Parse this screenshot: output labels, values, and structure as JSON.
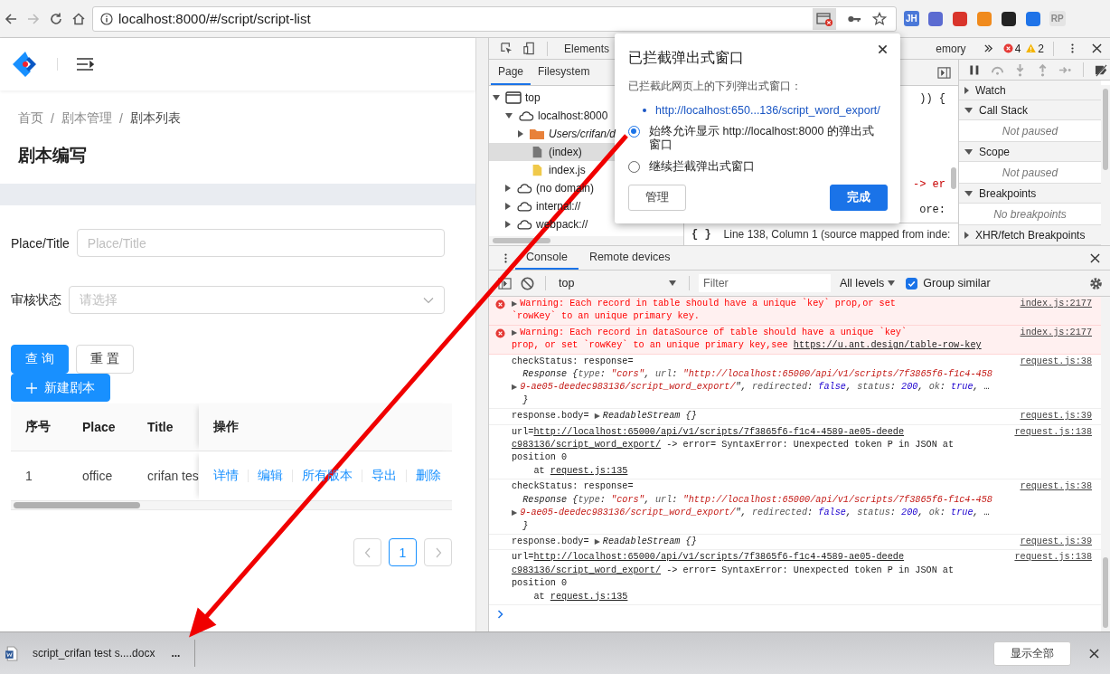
{
  "browser": {
    "url": "localhost:8000/#/script/script-list",
    "extensions": [
      {
        "kind": "badge",
        "label": "JH"
      },
      {
        "kind": "icon",
        "color": "#5b6bd1"
      },
      {
        "kind": "icon",
        "color": "#d9342b"
      },
      {
        "kind": "icon",
        "color": "#f08a1c"
      },
      {
        "kind": "icon",
        "color": "#222222"
      },
      {
        "kind": "icon",
        "color": "#1e73e8"
      },
      {
        "kind": "faded-badge",
        "label": "RP"
      }
    ]
  },
  "app": {
    "breadcrumb": [
      "首页",
      "剧本管理",
      "剧本列表"
    ],
    "breadcrumb_separator": "/",
    "page_title": "剧本编写",
    "form": [
      {
        "kind": "input",
        "label": "Place/Title",
        "placeholder": "Place/Title"
      },
      {
        "kind": "select",
        "label": "审核状态",
        "placeholder": "请选择"
      }
    ],
    "buttons": [
      {
        "kind": "primary",
        "label": "查 询"
      },
      {
        "kind": "default",
        "label": "重 置"
      }
    ],
    "new_button": "新建剧本",
    "table": {
      "columns": [
        "序号",
        "Place",
        "Title",
        "操作"
      ],
      "rows": [
        {
          "cells": [
            "1",
            "office",
            "crifan tes"
          ],
          "actions": [
            "详情",
            "编辑",
            "所有版本",
            "导出",
            "删除"
          ]
        }
      ]
    },
    "pagination": [
      {
        "kind": "prev"
      },
      {
        "kind": "page",
        "label": "1",
        "selected": true
      },
      {
        "kind": "next"
      }
    ]
  },
  "devtools": {
    "tabs": [
      {
        "label": "Elements",
        "selected": false
      },
      {
        "label": "emory",
        "selected": false
      }
    ],
    "errors": "4",
    "warnings": "2",
    "navigator": {
      "tabs": [
        {
          "label": "Page",
          "selected": true
        },
        {
          "label": "Filesystem",
          "selected": false
        }
      ],
      "tree": [
        {
          "kind": "frame",
          "label": "top",
          "expanded": true,
          "children": [
            {
              "kind": "cloud",
              "label": "localhost:8000",
              "expanded": true,
              "children": [
                {
                  "kind": "folder",
                  "label": "Users/crifan/d",
                  "expanded": false
                },
                {
                  "kind": "file",
                  "label": "(index)",
                  "selected": true
                },
                {
                  "kind": "script",
                  "label": "index.js",
                  "selected": false
                }
              ]
            },
            {
              "kind": "cloud",
              "label": "(no domain)",
              "expanded": false
            },
            {
              "kind": "cloud",
              "label": "internal://",
              "expanded": false
            },
            {
              "kind": "cloud",
              "label": "webpack://",
              "expanded": false
            }
          ]
        }
      ]
    },
    "code_fragments": [
      {
        "kind": "plain",
        "text": ")) {"
      },
      {
        "kind": "error",
        "text": "-> er"
      },
      {
        "kind": "plain",
        "text": "ore:"
      }
    ],
    "pretty_print": "{ }",
    "status": "Line 138, Column 1   (source mapped from inde:",
    "debugger": [
      {
        "title": "Watch",
        "expanded": false
      },
      {
        "title": "Call Stack",
        "expanded": true,
        "content": "Not paused"
      },
      {
        "title": "Scope",
        "expanded": true,
        "content": "Not paused"
      },
      {
        "title": "Breakpoints",
        "expanded": true,
        "content": "No breakpoints"
      },
      {
        "title": "XHR/fetch Breakpoints",
        "expanded": false
      }
    ],
    "console": {
      "tabs": [
        {
          "label": "Console",
          "selected": true
        },
        {
          "label": "Remote devices",
          "selected": false
        }
      ],
      "context": "top",
      "filter_placeholder": "Filter",
      "levels": "All levels",
      "group_similar": {
        "label": "Group similar",
        "checked": true
      },
      "messages": [
        {
          "kind": "error",
          "source": "index.js:2177",
          "lines": [
            [
              {
                "kind": "toggle",
                "t": "▶"
              },
              {
                "kind": "plain",
                "t": "Warning: Each record in table should have a unique `key` prop,or set"
              }
            ],
            [
              {
                "kind": "plain",
                "t": "`rowKey` to an unique primary key."
              }
            ]
          ]
        },
        {
          "kind": "error",
          "source": "index.js:2177",
          "lines": [
            [
              {
                "kind": "toggle",
                "t": "▶"
              },
              {
                "kind": "plain",
                "t": "Warning: Each record in dataSource of table should have a unique `key`"
              }
            ],
            [
              {
                "kind": "plain",
                "t": "prop, or set `rowKey` to an unique primary key,see "
              },
              {
                "kind": "link",
                "t": "https://u.ant.design/table-row-key"
              }
            ]
          ]
        },
        {
          "kind": "log",
          "source": "request.js:38",
          "lines": [
            [
              {
                "kind": "plain",
                "t": "checkStatus: response="
              }
            ],
            [
              {
                "kind": "italic",
                "t": "  Response {"
              },
              {
                "kind": "key",
                "t": "type"
              },
              {
                "kind": "italic",
                "t": ": "
              },
              {
                "kind": "string",
                "t": "\"cors\""
              },
              {
                "kind": "italic",
                "t": ", "
              },
              {
                "kind": "key",
                "t": "url"
              },
              {
                "kind": "italic",
                "t": ": "
              },
              {
                "kind": "string",
                "t": "\"http://localhost:65000/api/v1/scripts/7f3865f6-f1c4-458"
              }
            ],
            [
              {
                "kind": "toggle",
                "t": "▶"
              },
              {
                "kind": "string",
                "t": "9-ae05-deedec983136/script_word_export/"
              },
              {
                "kind": "italic",
                "t": "\", "
              },
              {
                "kind": "key",
                "t": "redirected"
              },
              {
                "kind": "italic",
                "t": ": "
              },
              {
                "kind": "value",
                "t": "false"
              },
              {
                "kind": "italic",
                "t": ", "
              },
              {
                "kind": "key",
                "t": "status"
              },
              {
                "kind": "italic",
                "t": ": "
              },
              {
                "kind": "value",
                "t": "200"
              },
              {
                "kind": "italic",
                "t": ", "
              },
              {
                "kind": "key",
                "t": "ok"
              },
              {
                "kind": "italic",
                "t": ": "
              },
              {
                "kind": "value",
                "t": "true"
              },
              {
                "kind": "italic",
                "t": ", …"
              }
            ],
            [
              {
                "kind": "italic",
                "t": "  }"
              }
            ]
          ]
        },
        {
          "kind": "log",
          "source": "request.js:39",
          "lines": [
            [
              {
                "kind": "plain",
                "t": "response.body= "
              },
              {
                "kind": "toggle",
                "t": "▶"
              },
              {
                "kind": "italic",
                "t": "ReadableStream {}"
              }
            ]
          ]
        },
        {
          "kind": "log",
          "source": "request.js:138",
          "lines": [
            [
              {
                "kind": "plain",
                "t": "url="
              },
              {
                "kind": "link",
                "t": "http://localhost:65000/api/v1/scripts/7f3865f6-f1c4-4589-ae05-deede"
              }
            ],
            [
              {
                "kind": "link",
                "t": "c983136/script_word_export/"
              },
              {
                "kind": "plain",
                "t": " -> error= SyntaxError: Unexpected token P in JSON at"
              }
            ],
            [
              {
                "kind": "plain",
                "t": "position 0"
              }
            ],
            [
              {
                "kind": "plain",
                "t": "    at "
              },
              {
                "kind": "link",
                "t": "request.js:135"
              }
            ]
          ]
        },
        {
          "kind": "log",
          "source": "request.js:38",
          "lines": [
            [
              {
                "kind": "plain",
                "t": "checkStatus: response="
              }
            ],
            [
              {
                "kind": "italic",
                "t": "  Response {"
              },
              {
                "kind": "key",
                "t": "type"
              },
              {
                "kind": "italic",
                "t": ": "
              },
              {
                "kind": "string",
                "t": "\"cors\""
              },
              {
                "kind": "italic",
                "t": ", "
              },
              {
                "kind": "key",
                "t": "url"
              },
              {
                "kind": "italic",
                "t": ": "
              },
              {
                "kind": "string",
                "t": "\"http://localhost:65000/api/v1/scripts/7f3865f6-f1c4-458"
              }
            ],
            [
              {
                "kind": "toggle",
                "t": "▶"
              },
              {
                "kind": "string",
                "t": "9-ae05-deedec983136/script_word_export/"
              },
              {
                "kind": "italic",
                "t": "\", "
              },
              {
                "kind": "key",
                "t": "redirected"
              },
              {
                "kind": "italic",
                "t": ": "
              },
              {
                "kind": "value",
                "t": "false"
              },
              {
                "kind": "italic",
                "t": ", "
              },
              {
                "kind": "key",
                "t": "status"
              },
              {
                "kind": "italic",
                "t": ": "
              },
              {
                "kind": "value",
                "t": "200"
              },
              {
                "kind": "italic",
                "t": ", "
              },
              {
                "kind": "key",
                "t": "ok"
              },
              {
                "kind": "italic",
                "t": ": "
              },
              {
                "kind": "value",
                "t": "true"
              },
              {
                "kind": "italic",
                "t": ", …"
              }
            ],
            [
              {
                "kind": "italic",
                "t": "  }"
              }
            ]
          ]
        },
        {
          "kind": "log",
          "source": "request.js:39",
          "lines": [
            [
              {
                "kind": "plain",
                "t": "response.body= "
              },
              {
                "kind": "toggle",
                "t": "▶"
              },
              {
                "kind": "italic",
                "t": "ReadableStream {}"
              }
            ]
          ]
        },
        {
          "kind": "log",
          "source": "request.js:138",
          "lines": [
            [
              {
                "kind": "plain",
                "t": "url="
              },
              {
                "kind": "link",
                "t": "http://localhost:65000/api/v1/scripts/7f3865f6-f1c4-4589-ae05-deede"
              }
            ],
            [
              {
                "kind": "link",
                "t": "c983136/script_word_export/"
              },
              {
                "kind": "plain",
                "t": " -> error= SyntaxError: Unexpected token P in JSON at"
              }
            ],
            [
              {
                "kind": "plain",
                "t": "position 0"
              }
            ],
            [
              {
                "kind": "plain",
                "t": "    at "
              },
              {
                "kind": "link",
                "t": "request.js:135"
              }
            ]
          ]
        }
      ]
    }
  },
  "popup": {
    "title": "已拦截弹出式窗口",
    "subtitle": "已拦截此网页上的下列弹出式窗口：",
    "link": "http://localhost:650...136/script_word_export/",
    "options": [
      {
        "label": "始终允许显示 http://localhost:8000 的弹出式窗口",
        "selected": true
      },
      {
        "label": "继续拦截弹出式窗口",
        "selected": false
      }
    ],
    "manage": "管理",
    "done": "完成"
  },
  "downloads": {
    "file": "script_crifan test s....docx",
    "more": "...",
    "show_all": "显示全部"
  }
}
